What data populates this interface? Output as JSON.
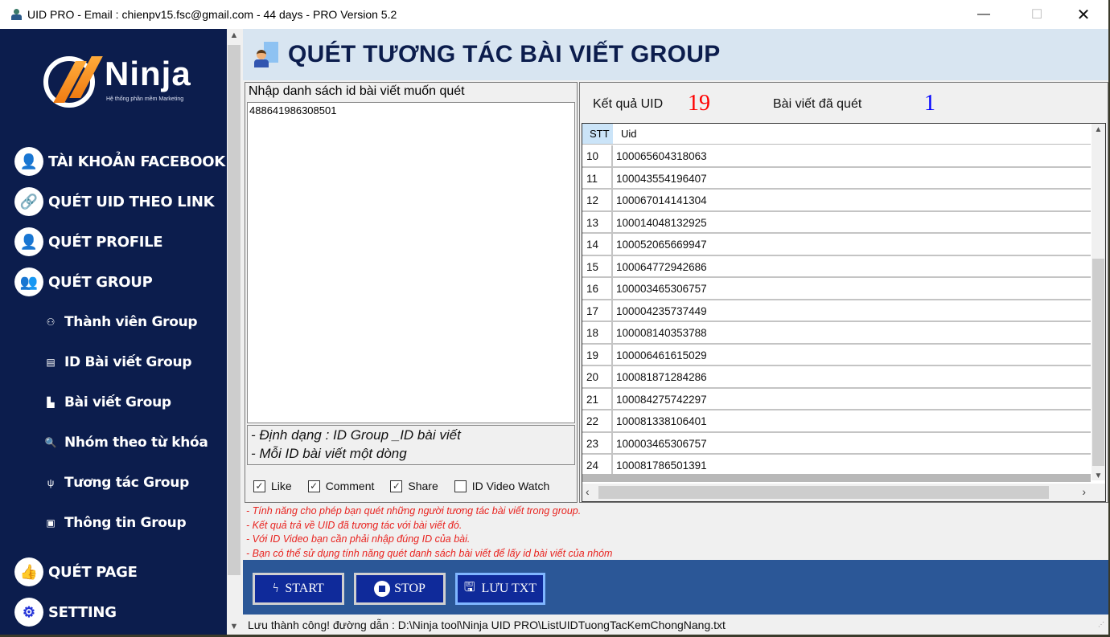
{
  "window": {
    "title": "UID PRO - Email : chienpv15.fsc@gmail.com - 44 days -  PRO Version 5.2",
    "minimize": "—",
    "maximize": "☐",
    "close": "✕"
  },
  "logo": {
    "word": "Ninja",
    "tagline": "Hệ thống phần mềm Marketing"
  },
  "sidebar": {
    "main_items": [
      {
        "label": "TÀI KHOẢN FACEBOOK",
        "icon": "user-icon",
        "glyph": "👤"
      },
      {
        "label": "QUÉT UID THEO LINK",
        "icon": "link-icon",
        "glyph": "🔗"
      },
      {
        "label": "QUÉT PROFILE",
        "icon": "profile-icon",
        "glyph": "👤"
      },
      {
        "label": "QUÉT GROUP",
        "icon": "group-icon",
        "glyph": "👥"
      },
      {
        "label": "QUÉT PAGE",
        "icon": "page-icon",
        "glyph": "👍"
      },
      {
        "label": "SETTING",
        "icon": "gear-icon",
        "glyph": "⚙"
      }
    ],
    "sub_items": [
      {
        "label": "Thành viên Group",
        "icon": "members-icon",
        "glyph": "⚇"
      },
      {
        "label": "ID Bài viết Group",
        "icon": "document-icon",
        "glyph": "▤"
      },
      {
        "label": "Bài viết Group",
        "icon": "post-icon",
        "glyph": "▙"
      },
      {
        "label": "Nhóm theo từ khóa",
        "icon": "search-icon",
        "glyph": "🔍"
      },
      {
        "label": "Tương tác Group",
        "icon": "usb-icon",
        "glyph": "ψ"
      },
      {
        "label": "Thông tin Group",
        "icon": "info-icon",
        "glyph": "▣"
      }
    ]
  },
  "header": {
    "title": "QUÉT TƯƠNG TÁC BÀI VIẾT GROUP"
  },
  "input_panel": {
    "title": "Nhập danh sách id bài viết muốn quét",
    "value": "488641986308501",
    "hint_lines": [
      "- Định dạng : ID Group _ID bài viết",
      "- Mỗi ID bài viết một dòng"
    ],
    "checkboxes": [
      {
        "label": "Like",
        "checked": true
      },
      {
        "label": "Comment",
        "checked": true
      },
      {
        "label": "Share",
        "checked": true
      },
      {
        "label": "ID Video Watch",
        "checked": false
      }
    ]
  },
  "results": {
    "uid_label": "Kết quả UID",
    "uid_count": "19",
    "uid_color": "#ff0000",
    "posts_label": "Bài viết đã quét",
    "posts_count": "1",
    "posts_color": "#0000ff",
    "columns": [
      "STT",
      "Uid"
    ],
    "rows": [
      {
        "stt": "10",
        "uid": "100065604318063"
      },
      {
        "stt": "11",
        "uid": "100043554196407"
      },
      {
        "stt": "12",
        "uid": "100067014141304"
      },
      {
        "stt": "13",
        "uid": "100014048132925"
      },
      {
        "stt": "14",
        "uid": "100052065669947"
      },
      {
        "stt": "15",
        "uid": "100064772942686"
      },
      {
        "stt": "16",
        "uid": "100003465306757"
      },
      {
        "stt": "17",
        "uid": "100004235737449"
      },
      {
        "stt": "18",
        "uid": "100008140353788"
      },
      {
        "stt": "19",
        "uid": "100006461615029"
      },
      {
        "stt": "20",
        "uid": "100081871284286"
      },
      {
        "stt": "21",
        "uid": "100084275742297"
      },
      {
        "stt": "22",
        "uid": "100081338106401"
      },
      {
        "stt": "23",
        "uid": "100003465306757"
      },
      {
        "stt": "24",
        "uid": "100081786501391"
      }
    ]
  },
  "notes": [
    "- Tính năng cho phép bạn quét những người tương tác bài viết trong group.",
    "- Kết quả trả về UID đã tương tác với bài viết đó.",
    "- Với ID Video bạn cần phải nhập đúng ID của bài.",
    "- Bạn có thể sử dụng tính năng quét danh sách bài viết để lấy id bài viết của nhóm"
  ],
  "actions": {
    "start": "START",
    "stop": "STOP",
    "save": "LƯU TXT"
  },
  "status": {
    "message": "Lưu thành công! đường dẫn : D:\\Ninja tool\\Ninja UID PRO\\ListUIDTuongTacKemChongNang.txt"
  },
  "colors": {
    "sidebar": "#0c1d4d",
    "header": "#d8e5f1",
    "action_bar": "#2b5797",
    "button": "#0f2a9a",
    "note_text": "#e8231f"
  }
}
